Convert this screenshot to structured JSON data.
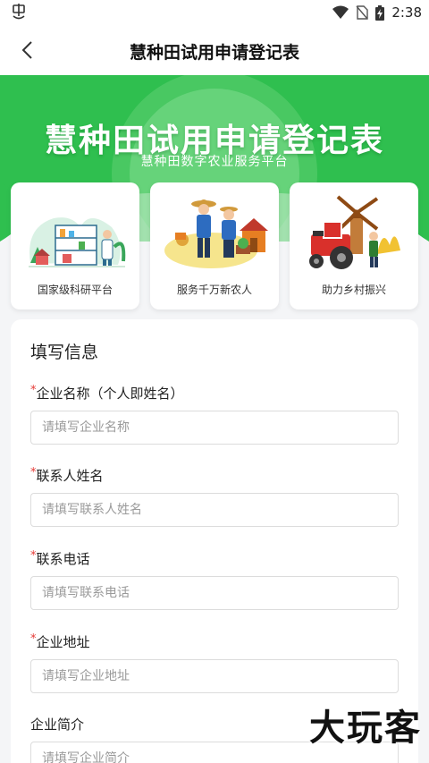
{
  "status_bar": {
    "time": "2:38",
    "icons": [
      "app-notification-icon",
      "wifi-icon",
      "no-sim-icon",
      "battery-charging-icon"
    ]
  },
  "app_bar": {
    "title": "慧种田试用申请登记表",
    "back_icon": "chevron-left-icon"
  },
  "hero": {
    "title": "慧种田试用申请登记表",
    "subtitle": "慧种田数字农业服务平台",
    "colors": {
      "primary_green": "#2fbf4f",
      "light_green": "#7fdc8d"
    }
  },
  "features": [
    {
      "label": "国家级科研平台",
      "icon": "research-lab-illustration"
    },
    {
      "label": "服务千万新农人",
      "icon": "farmers-illustration"
    },
    {
      "label": "助力乡村振兴",
      "icon": "tractor-windmill-illustration"
    }
  ],
  "form": {
    "section_title": "填写信息",
    "required_mark": "*",
    "fields": [
      {
        "label": "企业名称（个人即姓名）",
        "placeholder": "请填写企业名称",
        "value": ""
      },
      {
        "label": "联系人姓名",
        "placeholder": "请填写联系人姓名",
        "value": ""
      },
      {
        "label": "联系电话",
        "placeholder": "请填写联系电话",
        "value": ""
      },
      {
        "label": "企业地址",
        "placeholder": "请填写企业地址",
        "value": ""
      },
      {
        "label": "企业简介",
        "placeholder": "请填写企业简介",
        "value": ""
      }
    ]
  },
  "watermark": "大玩客"
}
